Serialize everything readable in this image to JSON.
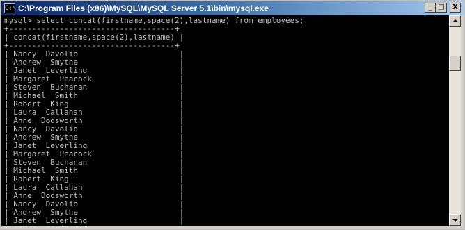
{
  "window": {
    "title": "C:\\Program Files (x86)\\MySQL\\MySQL Server 5.1\\bin\\mysql.exe",
    "controls": {
      "minimize": "_",
      "maximize": "□",
      "close": "X"
    }
  },
  "console": {
    "prompt": "mysql> select concat(firstname,space(2),lastname) from employees;",
    "border_top": "+------------------------------------+",
    "header": "| concat(firstname,space(2),lastname) |",
    "border_mid": "+------------------------------------+",
    "rows": [
      "| Nancy  Davolio                      |",
      "| Andrew  Smythe                      |",
      "| Janet  Leverling                    |",
      "| Margaret  Peacock                   |",
      "| Steven  Buchanan                    |",
      "| Michael  Smith                      |",
      "| Robert  King                        |",
      "| Laura  Callahan                     |",
      "| Anne  Dodsworth                     |",
      "| Nancy  Davolio                      |",
      "| Andrew  Smythe                      |",
      "| Janet  Leverling                    |",
      "| Margaret  Peacock                   |",
      "| Steven  Buchanan                    |",
      "| Michael  Smith                      |",
      "| Robert  King                        |",
      "| Laura  Callahan                     |",
      "| Anne  Dodsworth                     |",
      "| Nancy  Davolio                      |",
      "| Andrew  Smythe                      |",
      "| Janet  Leverling                    |"
    ]
  },
  "colors": {
    "console_bg": "#000000",
    "console_text": "#c0c0c0",
    "titlebar_start": "#0a246a",
    "titlebar_end": "#a6caf0"
  }
}
